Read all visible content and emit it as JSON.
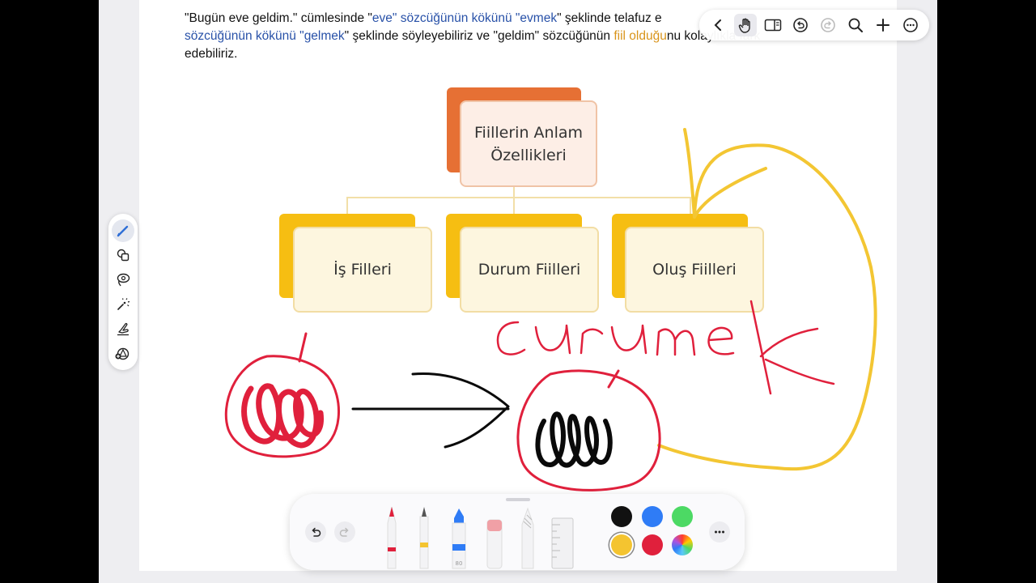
{
  "paragraph": {
    "t1": "\"Bugün eve geldim.\" cümlesinde \"",
    "t2": "eve\" sözcüğünün kökünü \"evmek",
    "t3": "\" şeklinde telafuz e",
    "t4": "sözcüğünün kökünü \"gelmek",
    "t5": "\" şeklinde söyleyebiliriz ve \"geldim\" sözcüğünün ",
    "t6": "fiil olduğu",
    "t7": "nu kolaylıkla fark",
    "t8": "edebiliriz."
  },
  "diagram": {
    "top": {
      "line1": "Fiillerin Anlam",
      "line2": "Özellikleri"
    },
    "children": [
      "İş Filleri",
      "Durum Fiilleri",
      "Oluş Fiilleri"
    ]
  },
  "handwriting": {
    "word": "çürümek"
  },
  "icons": {
    "top_toolbar": [
      "back-icon",
      "hand-icon",
      "reader-icon",
      "undo-history-icon",
      "redo-icon",
      "search-icon",
      "add-icon",
      "more-icon"
    ],
    "tool_rail": [
      "pen-icon",
      "shapes-icon",
      "lasso-icon",
      "laser-icon",
      "finger-draw-icon",
      "shapes-add-icon"
    ],
    "pen_toolbar": [
      "undo-icon",
      "redo-icon",
      "pen-tool",
      "marker-tool",
      "highlighter-tool",
      "eraser-tool",
      "pencil-tool",
      "ruler-tool",
      "more-icon"
    ]
  },
  "pen_toolbar": {
    "highlighter_size": "80"
  },
  "colors": {
    "orange_box": "#e67034",
    "yellow_box": "#f6be12",
    "ink_yellow": "#f3c633",
    "ink_red": "#e0203c",
    "ink_black": "#0a0a0a",
    "swatches": [
      "#111111",
      "#2f7cf6",
      "#4cd964",
      "#f4c430",
      "#e0203c",
      "multicolor"
    ]
  }
}
